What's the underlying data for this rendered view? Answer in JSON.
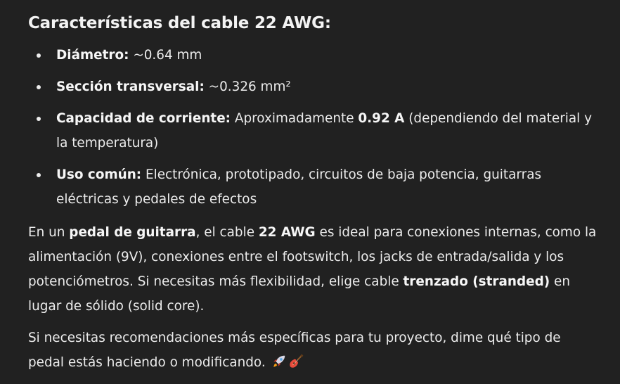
{
  "heading": "Características del cable 22 AWG:",
  "items": [
    {
      "label": "Diámetro:",
      "text": " ~0.64 mm"
    },
    {
      "label": "Sección transversal:",
      "text": " ~0.326 mm²"
    },
    {
      "label": "Capacidad de corriente:",
      "text_a": " Aproximadamente ",
      "bold": "0.92 A",
      "text_b": " (dependiendo del material y la temperatura)"
    },
    {
      "label": "Uso común:",
      "text": " Electrónica, prototipado, circuitos de baja potencia, guitarras eléctricas y pedales de efectos"
    }
  ],
  "paragraph1": {
    "t1": "En un ",
    "b1": "pedal de guitarra",
    "t2": ", el cable ",
    "b2": "22 AWG",
    "t3": " es ideal para conexiones internas, como la alimentación (9V), conexiones entre el footswitch, los jacks de entrada/salida y los potenciómetros. Si necesitas más flexibilidad, elige cable ",
    "b3": "trenzado (stranded)",
    "t4": " en lugar de sólido (solid core)."
  },
  "paragraph2": {
    "text": "Si necesitas recomendaciones más específicas para tu proyecto, dime qué tipo de pedal estás haciendo o modificando.",
    "emojis": [
      "rocket-emoji",
      "guitar-emoji"
    ]
  }
}
